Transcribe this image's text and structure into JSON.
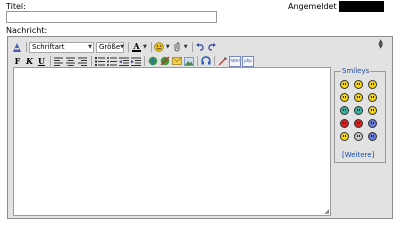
{
  "form": {
    "title_label": "Titel:",
    "title_value": "",
    "logged_in_label": "Angemeldet als",
    "message_label": "Nachricht:"
  },
  "toolbar": {
    "font_select": "Schriftart",
    "size_select": "Größe",
    "bold": "F",
    "italic": "K",
    "underline": "U",
    "html_label": "html",
    "php_label": "php",
    "collapse_glyph": "▲▼"
  },
  "smileys": {
    "legend": "Smileys",
    "more_link": "[Weitere]",
    "colors": [
      "#f3d31c",
      "#f3d31c",
      "#f3d31c",
      "#f3d31c",
      "#f3d31c",
      "#f3d31c",
      "#3cb3a3",
      "#3cb3a3",
      "#f3d31c",
      "#d82020",
      "#d82020",
      "#6a7ad8",
      "#f3d31c",
      "#c8c8c8",
      "#6a7ad8"
    ]
  },
  "colors": {
    "editor_bg": "#e2e2e2",
    "link": "#1a4aa8",
    "text_color_bar": "#000000"
  }
}
